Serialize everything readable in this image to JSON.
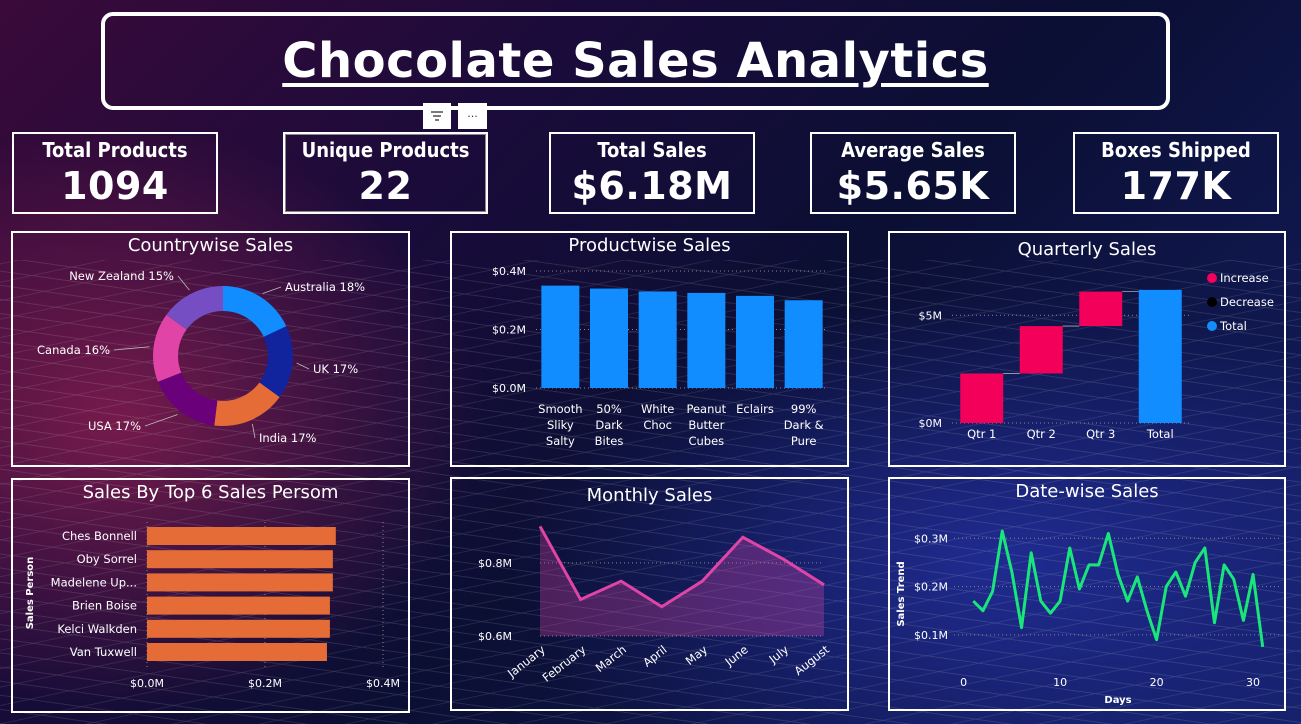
{
  "title": "Chocolate Sales Analytics",
  "kpis": {
    "total_products": {
      "label": "Total Products",
      "value": "1094"
    },
    "unique_products": {
      "label": "Unique Products",
      "value": "22"
    },
    "total_sales": {
      "label": "Total Sales",
      "value": "$6.18M"
    },
    "average_sales": {
      "label": "Average Sales",
      "value": "$5.65K"
    },
    "boxes_shipped": {
      "label": "Boxes Shipped",
      "value": "177K"
    }
  },
  "toolbar": {
    "filter_icon": "filter-icon",
    "more_label": "···"
  },
  "panels": {
    "countrywise": "Countrywise Sales",
    "productwise": "Productwise Sales",
    "quarterly": "Quarterly Sales",
    "salesperson": "Sales By Top 6 Sales Persom",
    "monthly": "Monthly Sales",
    "datewise": "Date-wise Sales"
  },
  "chart_data": [
    {
      "id": "countrywise",
      "type": "pie",
      "donut": true,
      "categories": [
        "Australia",
        "UK",
        "India",
        "USA",
        "Canada",
        "New Zealand"
      ],
      "values": [
        18,
        17,
        17,
        17,
        16,
        15
      ],
      "labels": [
        "Australia 18%",
        "UK 17%",
        "India 17%",
        "USA 17%",
        "Canada 16%",
        "New Zealand 15%"
      ],
      "colors": [
        "#118DFF",
        "#12239E",
        "#E66C37",
        "#6B007B",
        "#E044A7",
        "#744EC2"
      ]
    },
    {
      "id": "productwise",
      "type": "bar",
      "categories": [
        [
          "Smooth",
          "Sliky",
          "Salty"
        ],
        [
          "50%",
          "Dark",
          "Bites"
        ],
        [
          "White",
          "Choc"
        ],
        [
          "Peanut",
          "Butter",
          "Cubes"
        ],
        [
          "Eclairs"
        ],
        [
          "99%",
          "Dark &",
          "Pure"
        ]
      ],
      "values": [
        0.35,
        0.34,
        0.33,
        0.325,
        0.315,
        0.3
      ],
      "yticks": [
        "$0.0M",
        "$0.2M",
        "$0.4M"
      ],
      "ylim": [
        0,
        0.4
      ],
      "color": "#118DFF"
    },
    {
      "id": "quarterly",
      "type": "bar",
      "subtype": "waterfall",
      "categories": [
        "Qtr 1",
        "Qtr 2",
        "Qtr 3",
        "Total"
      ],
      "values": [
        2.3,
        2.2,
        1.6,
        6.18
      ],
      "yticks": [
        "$0M",
        "$5M"
      ],
      "ylim": [
        0,
        6.5
      ],
      "legend": [
        {
          "name": "Increase",
          "color": "#F2005A"
        },
        {
          "name": "Decrease",
          "color": "#000000"
        },
        {
          "name": "Total",
          "color": "#118DFF"
        }
      ],
      "legend_position": "top-right"
    },
    {
      "id": "salesperson",
      "type": "bar",
      "orientation": "horizontal",
      "categories": [
        "Ches Bonnell",
        "Oby Sorrel",
        "Madelene Up...",
        "Brien Boise",
        "Kelci Walkden",
        "Van Tuxwell"
      ],
      "values": [
        0.32,
        0.315,
        0.315,
        0.31,
        0.31,
        0.305
      ],
      "xticks": [
        "$0.0M",
        "$0.2M",
        "$0.4M"
      ],
      "xlim": [
        0,
        0.4
      ],
      "ylabel": "Sales Person",
      "color": "#E66C37"
    },
    {
      "id": "monthly",
      "type": "area",
      "categories": [
        "January",
        "February",
        "March",
        "April",
        "May",
        "June",
        "July",
        "August"
      ],
      "values": [
        0.9,
        0.7,
        0.75,
        0.68,
        0.75,
        0.87,
        0.81,
        0.74
      ],
      "yticks": [
        "$0.6M",
        "$0.8M"
      ],
      "ylim": [
        0.6,
        0.92
      ],
      "color": "#E044A7"
    },
    {
      "id": "datewise",
      "type": "line",
      "x": [
        1,
        2,
        3,
        4,
        5,
        6,
        7,
        8,
        9,
        10,
        11,
        12,
        13,
        14,
        15,
        16,
        17,
        18,
        19,
        20,
        21,
        22,
        23,
        24,
        25,
        26,
        27,
        28,
        29,
        30,
        31
      ],
      "values": [
        0.17,
        0.15,
        0.19,
        0.315,
        0.23,
        0.115,
        0.27,
        0.17,
        0.145,
        0.17,
        0.28,
        0.195,
        0.245,
        0.245,
        0.31,
        0.225,
        0.17,
        0.22,
        0.15,
        0.09,
        0.2,
        0.23,
        0.18,
        0.25,
        0.28,
        0.125,
        0.245,
        0.215,
        0.13,
        0.225,
        0.075
      ],
      "xticks": [
        0,
        10,
        20,
        30
      ],
      "xlim": [
        -1,
        33
      ],
      "yticks": [
        "$0.1M",
        "$0.2M",
        "$0.3M"
      ],
      "ylim": [
        0.05,
        0.34
      ],
      "xlabel": "Days",
      "ylabel": "Sales Trend",
      "color": "#19E67A"
    }
  ]
}
